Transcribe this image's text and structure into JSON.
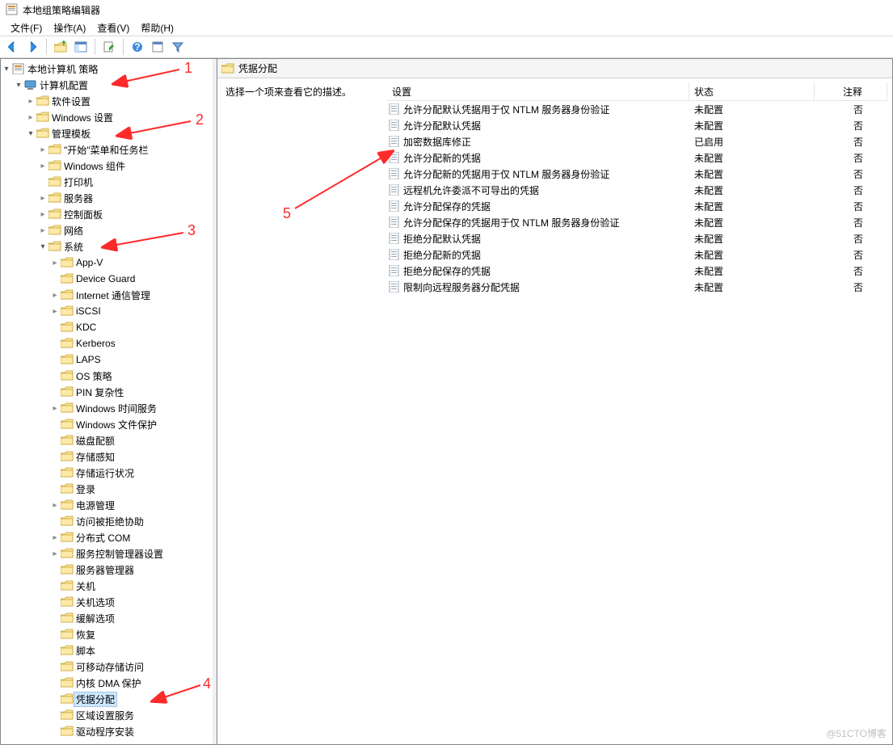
{
  "window": {
    "title": "本地组策略编辑器"
  },
  "menus": {
    "file": "文件(F)",
    "action": "操作(A)",
    "view": "查看(V)",
    "help": "帮助(H)"
  },
  "right": {
    "header_title": "凭据分配",
    "desc_prompt": "选择一个项来查看它的描述。",
    "columns": {
      "setting": "设置",
      "status": "状态",
      "comment": "注释"
    },
    "rows": [
      {
        "name": "允许分配默认凭据用于仅 NTLM 服务器身份验证",
        "status": "未配置",
        "comment": "否"
      },
      {
        "name": "允许分配默认凭据",
        "status": "未配置",
        "comment": "否"
      },
      {
        "name": "加密数据库修正",
        "status": "已启用",
        "comment": "否"
      },
      {
        "name": "允许分配新的凭据",
        "status": "未配置",
        "comment": "否"
      },
      {
        "name": "允许分配新的凭据用于仅 NTLM 服务器身份验证",
        "status": "未配置",
        "comment": "否"
      },
      {
        "name": "远程机允许委派不可导出的凭据",
        "status": "未配置",
        "comment": "否"
      },
      {
        "name": "允许分配保存的凭据",
        "status": "未配置",
        "comment": "否"
      },
      {
        "name": "允许分配保存的凭据用于仅 NTLM 服务器身份验证",
        "status": "未配置",
        "comment": "否"
      },
      {
        "name": "拒绝分配默认凭据",
        "status": "未配置",
        "comment": "否"
      },
      {
        "name": "拒绝分配新的凭据",
        "status": "未配置",
        "comment": "否"
      },
      {
        "name": "拒绝分配保存的凭据",
        "status": "未配置",
        "comment": "否"
      },
      {
        "name": "限制向远程服务器分配凭据",
        "status": "未配置",
        "comment": "否"
      }
    ]
  },
  "tree": [
    {
      "d": 0,
      "l": "本地计算机 策略",
      "t": "expanded",
      "i": "book"
    },
    {
      "d": 1,
      "l": "计算机配置",
      "t": "expanded",
      "i": "computer"
    },
    {
      "d": 2,
      "l": "软件设置",
      "t": "collapsed",
      "i": "folder"
    },
    {
      "d": 2,
      "l": "Windows 设置",
      "t": "collapsed",
      "i": "folder"
    },
    {
      "d": 2,
      "l": "管理模板",
      "t": "expanded",
      "i": "folder"
    },
    {
      "d": 3,
      "l": "\"开始\"菜单和任务栏",
      "t": "collapsed",
      "i": "folder"
    },
    {
      "d": 3,
      "l": "Windows 组件",
      "t": "collapsed",
      "i": "folder"
    },
    {
      "d": 3,
      "l": "打印机",
      "t": "none",
      "i": "folder"
    },
    {
      "d": 3,
      "l": "服务器",
      "t": "collapsed",
      "i": "folder"
    },
    {
      "d": 3,
      "l": "控制面板",
      "t": "collapsed",
      "i": "folder"
    },
    {
      "d": 3,
      "l": "网络",
      "t": "collapsed",
      "i": "folder"
    },
    {
      "d": 3,
      "l": "系统",
      "t": "expanded",
      "i": "folder"
    },
    {
      "d": 4,
      "l": "App-V",
      "t": "collapsed",
      "i": "folder"
    },
    {
      "d": 4,
      "l": "Device Guard",
      "t": "none",
      "i": "folder"
    },
    {
      "d": 4,
      "l": "Internet 通信管理",
      "t": "collapsed",
      "i": "folder"
    },
    {
      "d": 4,
      "l": "iSCSI",
      "t": "collapsed",
      "i": "folder"
    },
    {
      "d": 4,
      "l": "KDC",
      "t": "none",
      "i": "folder"
    },
    {
      "d": 4,
      "l": "Kerberos",
      "t": "none",
      "i": "folder"
    },
    {
      "d": 4,
      "l": "LAPS",
      "t": "none",
      "i": "folder"
    },
    {
      "d": 4,
      "l": "OS 策略",
      "t": "none",
      "i": "folder"
    },
    {
      "d": 4,
      "l": "PIN 复杂性",
      "t": "none",
      "i": "folder"
    },
    {
      "d": 4,
      "l": "Windows 时间服务",
      "t": "collapsed",
      "i": "folder"
    },
    {
      "d": 4,
      "l": "Windows 文件保护",
      "t": "none",
      "i": "folder"
    },
    {
      "d": 4,
      "l": "磁盘配额",
      "t": "none",
      "i": "folder"
    },
    {
      "d": 4,
      "l": "存储感知",
      "t": "none",
      "i": "folder"
    },
    {
      "d": 4,
      "l": "存储运行状况",
      "t": "none",
      "i": "folder"
    },
    {
      "d": 4,
      "l": "登录",
      "t": "none",
      "i": "folder"
    },
    {
      "d": 4,
      "l": "电源管理",
      "t": "collapsed",
      "i": "folder"
    },
    {
      "d": 4,
      "l": "访问被拒绝协助",
      "t": "none",
      "i": "folder"
    },
    {
      "d": 4,
      "l": "分布式 COM",
      "t": "collapsed",
      "i": "folder"
    },
    {
      "d": 4,
      "l": "服务控制管理器设置",
      "t": "collapsed",
      "i": "folder"
    },
    {
      "d": 4,
      "l": "服务器管理器",
      "t": "none",
      "i": "folder"
    },
    {
      "d": 4,
      "l": "关机",
      "t": "none",
      "i": "folder"
    },
    {
      "d": 4,
      "l": "关机选项",
      "t": "none",
      "i": "folder"
    },
    {
      "d": 4,
      "l": "缓解选项",
      "t": "none",
      "i": "folder"
    },
    {
      "d": 4,
      "l": "恢复",
      "t": "none",
      "i": "folder"
    },
    {
      "d": 4,
      "l": "脚本",
      "t": "none",
      "i": "folder"
    },
    {
      "d": 4,
      "l": "可移动存储访问",
      "t": "none",
      "i": "folder"
    },
    {
      "d": 4,
      "l": "内核 DMA 保护",
      "t": "none",
      "i": "folder"
    },
    {
      "d": 4,
      "l": "凭据分配",
      "t": "none",
      "i": "folder",
      "sel": true
    },
    {
      "d": 4,
      "l": "区域设置服务",
      "t": "none",
      "i": "folder"
    },
    {
      "d": 4,
      "l": "驱动程序安装",
      "t": "none",
      "i": "folder"
    }
  ],
  "annotations": {
    "n1": "1",
    "n2": "2",
    "n3": "3",
    "n4": "4",
    "n5": "5"
  },
  "watermark": "@51CTO博客"
}
